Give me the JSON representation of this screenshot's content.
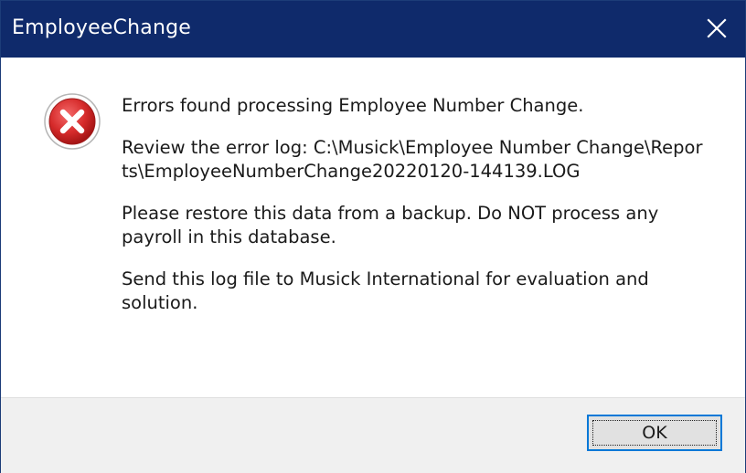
{
  "window": {
    "title": "EmployeeChange",
    "close_icon": "close-icon"
  },
  "dialog": {
    "icon": "error-icon",
    "messages": [
      "Errors found processing Employee Number Change.",
      "Review the error log: C:\\Musick\\Employee Number Change\\Reports\\EmployeeNumberChange20220120-144139.LOG",
      "Please restore this data from a backup. Do NOT process any payroll in this database.",
      "Send this log file to Musick International for evaluation and solution."
    ]
  },
  "buttons": {
    "ok_label": "OK"
  },
  "colors": {
    "titlebar": "#0f2a6b",
    "error_red": "#d62b2b",
    "footer": "#f0f0f0",
    "focus_border": "#0078d7"
  }
}
